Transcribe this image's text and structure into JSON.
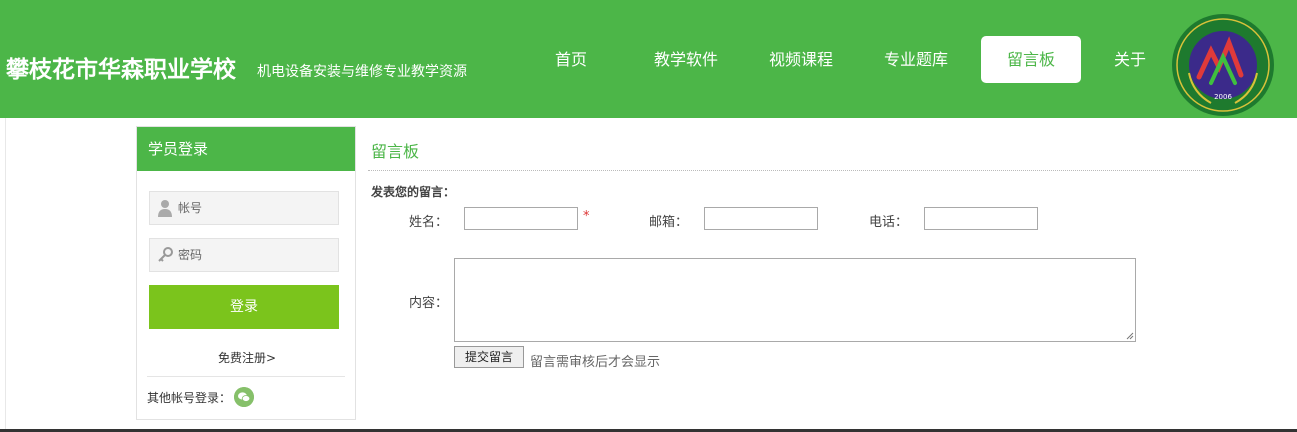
{
  "header": {
    "title": "攀枝花市华森职业学校",
    "subtitle": "机电设备安装与维修专业教学资源",
    "nav": [
      {
        "label": "首页",
        "active": false
      },
      {
        "label": "教学软件",
        "active": false
      },
      {
        "label": "视频课程",
        "active": false
      },
      {
        "label": "专业题库",
        "active": false
      },
      {
        "label": "留言板",
        "active": true
      },
      {
        "label": "关于",
        "active": false
      }
    ],
    "logo_year": "2006"
  },
  "login": {
    "title": "学员登录",
    "account_placeholder": "帐号",
    "password_placeholder": "密码",
    "login_button": "登录",
    "register_link": "免费注册>",
    "other_login": "其他帐号登录："
  },
  "board": {
    "title": "留言板",
    "heading": "发表您的留言：",
    "name_label": "姓名：",
    "required_mark": "*",
    "email_label": "邮箱：",
    "phone_label": "电话：",
    "content_label": "内容：",
    "submit_button": "提交留言",
    "note": "留言需审核后才会显示"
  },
  "colors": {
    "brand_green": "#4cb648",
    "login_button": "#7bc41c",
    "required": "#dd3333"
  }
}
